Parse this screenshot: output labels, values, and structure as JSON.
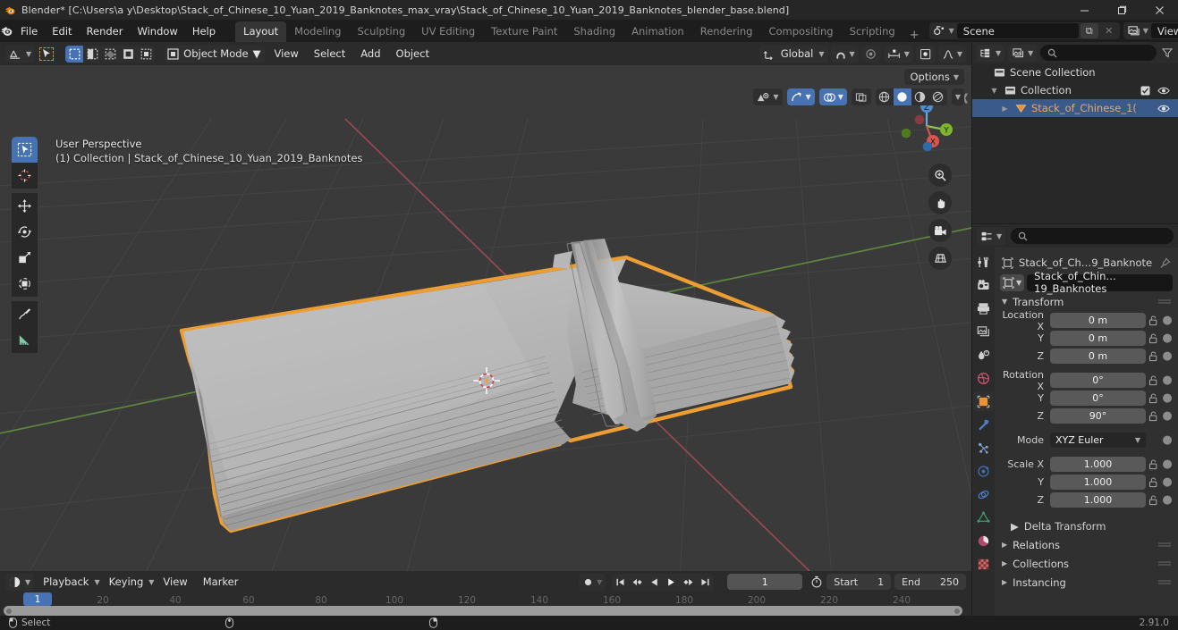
{
  "window": {
    "title": "Blender* [C:\\Users\\a y\\Desktop\\Stack_of_Chinese_10_Yuan_2019_Banknotes_max_vray\\Stack_of_Chinese_10_Yuan_2019_Banknotes_blender_base.blend]",
    "minimize": "–",
    "maximize": "❐",
    "close": "✕"
  },
  "menus": [
    "File",
    "Edit",
    "Render",
    "Window",
    "Help"
  ],
  "workspaces": [
    {
      "label": "Layout",
      "active": true
    },
    {
      "label": "Modeling",
      "active": false
    },
    {
      "label": "Sculpting",
      "active": false
    },
    {
      "label": "UV Editing",
      "active": false
    },
    {
      "label": "Texture Paint",
      "active": false
    },
    {
      "label": "Shading",
      "active": false
    },
    {
      "label": "Animation",
      "active": false
    },
    {
      "label": "Rendering",
      "active": false
    },
    {
      "label": "Compositing",
      "active": false
    },
    {
      "label": "Scripting",
      "active": false
    }
  ],
  "workspace_add": "+",
  "scene": {
    "name": "Scene",
    "new_label": "⧉",
    "unlink_label": "✕"
  },
  "view_layer": {
    "name": "View Layer",
    "new_label": "⧉",
    "unlink_label": "✕"
  },
  "viewport": {
    "mode": "Object Mode",
    "menus": [
      "View",
      "Select",
      "Add",
      "Object"
    ],
    "transform_orientation": "Global",
    "options_label": "Options",
    "info_line1": "User Perspective",
    "info_line2": "(1) Collection | Stack_of_Chinese_10_Yuan_2019_Banknotes",
    "gizmo_axes": [
      "Z",
      "Y",
      "X"
    ],
    "model_name": "Stack of Chinese 10 Yuan 2019 Banknotes",
    "select_outline_color": "#ed9e33",
    "background_color": "#3a3a3a",
    "model_color": "#b4b4b4"
  },
  "outliner": {
    "search_placeholder": "",
    "rows": [
      {
        "label": "Scene Collection",
        "icon": "collection-icon",
        "indent": 0,
        "selected": false,
        "disclosure": "",
        "checkbox": false,
        "eye": false
      },
      {
        "label": "Collection",
        "icon": "collection-icon",
        "indent": 1,
        "selected": false,
        "disclosure": "▼",
        "checkbox": true,
        "eye": true
      },
      {
        "label": "Stack_of_Chinese_1(",
        "icon": "mesh-object-icon",
        "indent": 2,
        "selected": true,
        "disclosure": "▶",
        "checkbox": false,
        "eye": true
      }
    ]
  },
  "properties": {
    "breadcrumb_object": "Stack_of_Ch…9_Banknote",
    "object_name": "Stack_of_Chin…19_Banknotes",
    "tabs": [
      "tool-icon",
      "render-icon",
      "output-icon",
      "view-layer-icon",
      "scene-icon",
      "world-icon",
      "object-icon",
      "modifier-icon",
      "particles-icon",
      "physics-icon",
      "constraint-icon",
      "data-icon",
      "material-icon",
      "texture-icon"
    ],
    "active_tab_index": 6,
    "transform": {
      "title": "Transform",
      "rows": [
        {
          "label": "Location X",
          "value": "0 m"
        },
        {
          "label": "Y",
          "value": "0 m"
        },
        {
          "label": "Z",
          "value": "0 m"
        },
        {
          "label": "Rotation X",
          "value": "0°"
        },
        {
          "label": "Y",
          "value": "0°"
        },
        {
          "label": "Z",
          "value": "90°"
        },
        {
          "label": "Mode",
          "value": "XYZ Euler",
          "dropdown": true
        },
        {
          "label": "Scale X",
          "value": "1.000"
        },
        {
          "label": "Y",
          "value": "1.000"
        },
        {
          "label": "Z",
          "value": "1.000"
        }
      ]
    },
    "sub_panels": [
      "Delta Transform"
    ],
    "panels": [
      "Relations",
      "Collections",
      "Instancing"
    ]
  },
  "timeline": {
    "editor_label": "",
    "menus": [
      "Playback",
      "Keying",
      "View",
      "Marker"
    ],
    "current_frame": "1",
    "start_label": "Start",
    "start_value": "1",
    "end_label": "End",
    "end_value": "250",
    "playhead_frame": "1",
    "ticks": [
      "20",
      "40",
      "60",
      "80",
      "100",
      "120",
      "140",
      "160",
      "180",
      "200",
      "220",
      "240"
    ]
  },
  "statusbar": {
    "mouse_left_action": "Select",
    "version": "2.91.0"
  }
}
